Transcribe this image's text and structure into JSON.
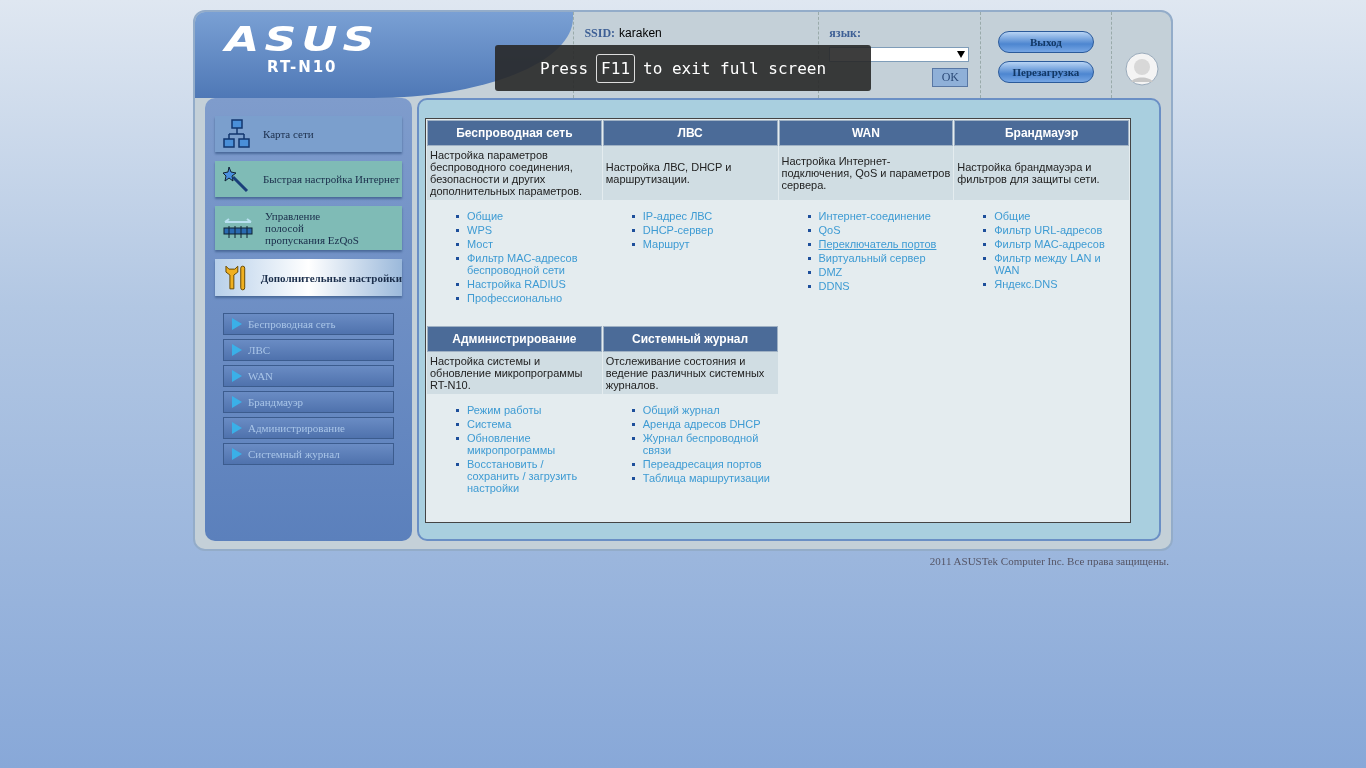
{
  "header": {
    "logo": "ASUS",
    "model": "RT-N10",
    "ssid_label": "SSID:",
    "ssid": "karaken",
    "language_label": "язык:",
    "ok_button": "OK",
    "buttons": [
      "Выход",
      "Перезагрузка"
    ]
  },
  "overlay": {
    "before": "Press",
    "key": "F11",
    "after": "to exit full screen"
  },
  "menu": [
    {
      "kind": "map",
      "label": "Карта сети",
      "selected": false
    },
    {
      "kind": "wizard",
      "label": "Быстрая настройка Интернет",
      "selected": false
    },
    {
      "kind": "qos",
      "label": "Управление\nполосой\nпропускания EzQoS",
      "selected": false
    },
    {
      "kind": "tools",
      "label": "Дополнительные настройки",
      "selected": true
    }
  ],
  "submenu": [
    "Беспроводная сеть",
    "ЛВС",
    "WAN",
    "Брандмауэр",
    "Администрирование",
    "Системный журнал"
  ],
  "sections": [
    {
      "title": "Беспроводная сеть",
      "description": "Настройка параметров беспроводного соединения, безопасности и других дополнительных параметров.",
      "links": [
        {
          "label": "Общие",
          "hovered": false
        },
        {
          "label": "WPS",
          "hovered": false
        },
        {
          "label": "Мост",
          "hovered": false
        },
        {
          "label": "Фильтр MAC-адресов беспроводной сети",
          "hovered": false
        },
        {
          "label": "Настройка RADIUS",
          "hovered": false
        },
        {
          "label": "Профессионально",
          "hovered": false
        }
      ]
    },
    {
      "title": "ЛВС",
      "description": "Настройка ЛВС, DHCP и маршрутизации.",
      "links": [
        {
          "label": "IP-адрес ЛВС",
          "hovered": false
        },
        {
          "label": "DHCP-сервер",
          "hovered": false
        },
        {
          "label": "Маршрут",
          "hovered": false
        }
      ]
    },
    {
      "title": "WAN",
      "description": "Настройка Интернет-подключения, QoS и параметров сервера.",
      "links": [
        {
          "label": "Интернет-соединение",
          "hovered": false
        },
        {
          "label": "QoS",
          "hovered": false
        },
        {
          "label": "Переключатель портов",
          "hovered": true
        },
        {
          "label": "Виртуальный сервер",
          "hovered": false
        },
        {
          "label": "DMZ",
          "hovered": false
        },
        {
          "label": "DDNS",
          "hovered": false
        }
      ]
    },
    {
      "title": "Брандмауэр",
      "description": "Настройка брандмауэра и фильтров для защиты сети.",
      "links": [
        {
          "label": "Общие",
          "hovered": false
        },
        {
          "label": "Фильтр URL-адресов",
          "hovered": false
        },
        {
          "label": "Фильтр MAC-адресов",
          "hovered": false
        },
        {
          "label": "Фильтр между LAN и WAN",
          "hovered": false
        },
        {
          "label": "Яндекс.DNS",
          "hovered": false
        }
      ]
    },
    {
      "title": "Администрирование",
      "description": "Настройка системы и обновление микропрограммы RT-N10.",
      "links": [
        {
          "label": "Режим работы",
          "hovered": false
        },
        {
          "label": "Система",
          "hovered": false
        },
        {
          "label": "Обновление микропрограммы",
          "hovered": false
        },
        {
          "label": "Восстановить / сохранить / загрузить настройки",
          "hovered": false
        }
      ]
    },
    {
      "title": "Системный журнал",
      "description": "Отслеживание состояния и ведение различных системных журналов.",
      "links": [
        {
          "label": "Общий журнал",
          "hovered": false
        },
        {
          "label": "Аренда адресов DHCP",
          "hovered": false
        },
        {
          "label": "Журнал беспроводной связи",
          "hovered": false
        },
        {
          "label": "Переадресация портов",
          "hovered": false
        },
        {
          "label": "Таблица маршрутизации",
          "hovered": false
        }
      ]
    }
  ],
  "footer": "2011 ASUSTek Computer Inc. Все права защищены."
}
